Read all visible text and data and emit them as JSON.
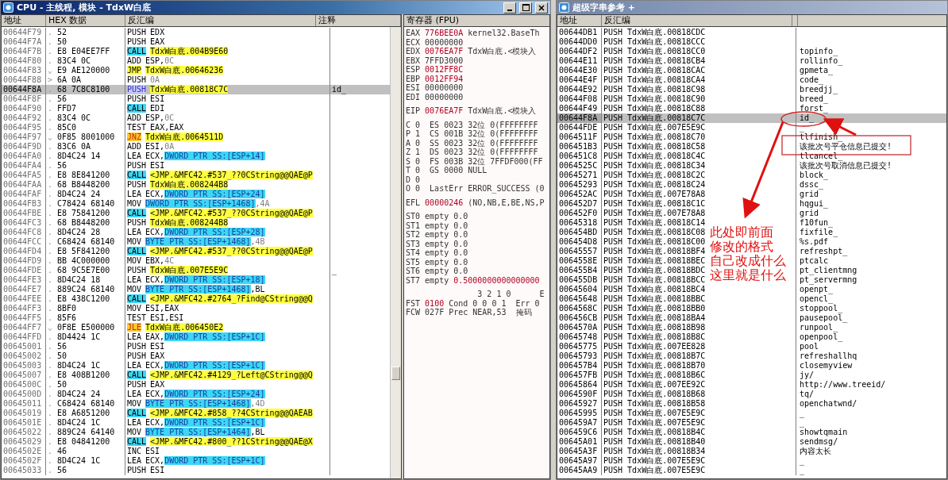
{
  "cpu_window": {
    "title": "CPU - 主线程, 模块 - TdxW白底"
  },
  "disasm": {
    "columns": [
      "地址",
      "HEX 数据",
      "反汇编",
      "注释"
    ],
    "rows": [
      {
        "address": "00644F79",
        "marker": ".",
        "hex": "52",
        "asm": [
          {
            "text": "PUSH",
            "kind": "plain"
          },
          {
            "text": "EDX",
            "kind": "plain"
          }
        ],
        "selected": false
      },
      {
        "address": "00644F7A",
        "marker": ".",
        "hex": "50",
        "asm": [
          {
            "text": "PUSH",
            "kind": "plain"
          },
          {
            "text": "EAX",
            "kind": "plain"
          }
        ],
        "selected": false
      },
      {
        "address": "00644F7B",
        "marker": ".",
        "hex": "E8 E04EE7FF",
        "asm": [
          {
            "text": "CALL",
            "kind": "call"
          },
          {
            "text": "TdxW白底.004B9E60",
            "kind": "target"
          }
        ],
        "selected": false
      },
      {
        "address": "00644F80",
        "marker": ".",
        "hex": "83C4 0C",
        "asm": [
          {
            "text": "ADD",
            "kind": "plain"
          },
          {
            "text": "ESP,",
            "kind": "plain"
          },
          {
            "text": "0C",
            "kind": "num"
          }
        ],
        "selected": false
      },
      {
        "address": "00644F83",
        "marker": "⌄",
        "hex": "E9 AE120000",
        "asm": [
          {
            "text": "JMP",
            "kind": "jmp"
          },
          {
            "text": "TdxW白底.00646236",
            "kind": "target"
          }
        ],
        "selected": false
      },
      {
        "address": "00644F88",
        "marker": ">",
        "hex": "6A 0A",
        "asm": [
          {
            "text": "PUSH",
            "kind": "plain"
          },
          {
            "text": "0A",
            "kind": "num"
          }
        ],
        "selected": false
      },
      {
        "address": "00644F8A",
        "marker": ".",
        "hex": "68 7C8C8100",
        "asm": [
          {
            "text": "PUSH",
            "kind": "mark"
          },
          {
            "text": "TdxW白底.00818C7C",
            "kind": "target"
          }
        ],
        "comment": "id_",
        "selected": true
      },
      {
        "address": "00644F8F",
        "marker": ".",
        "hex": "56",
        "asm": [
          {
            "text": "PUSH",
            "kind": "plain"
          },
          {
            "text": "ESI",
            "kind": "plain"
          }
        ],
        "selected": false
      },
      {
        "address": "00644F90",
        "marker": ".",
        "hex": "FFD7",
        "asm": [
          {
            "text": "CALL",
            "kind": "call"
          },
          {
            "text": "EDI",
            "kind": "plain"
          }
        ],
        "selected": false
      },
      {
        "address": "00644F92",
        "marker": ".",
        "hex": "83C4 0C",
        "asm": [
          {
            "text": "ADD",
            "kind": "plain"
          },
          {
            "text": "ESP,",
            "kind": "plain"
          },
          {
            "text": "0C",
            "kind": "num"
          }
        ],
        "selected": false
      },
      {
        "address": "00644F95",
        "marker": ".",
        "hex": "85C0",
        "asm": [
          {
            "text": "TEST",
            "kind": "plain"
          },
          {
            "text": "EAX,EAX",
            "kind": "plain"
          }
        ],
        "selected": false
      },
      {
        "address": "00644F97",
        "marker": "⌄",
        "hex": "0F85 8001000",
        "asm": [
          {
            "text": "JNZ",
            "kind": "jump"
          },
          {
            "text": "TdxW白底.0064511D",
            "kind": "target"
          }
        ],
        "selected": false
      },
      {
        "address": "00644F9D",
        "marker": ".",
        "hex": "83C6 0A",
        "asm": [
          {
            "text": "ADD",
            "kind": "plain"
          },
          {
            "text": "ESI,",
            "kind": "plain"
          },
          {
            "text": "0A",
            "kind": "num"
          }
        ],
        "selected": false
      },
      {
        "address": "00644FA0",
        "marker": ".",
        "hex": "8D4C24 14",
        "asm": [
          {
            "text": "LEA",
            "kind": "plain"
          },
          {
            "text": "ECX,",
            "kind": "plain"
          },
          {
            "text": "DWORD PTR SS:[ESP+14]",
            "kind": "mem"
          }
        ],
        "selected": false
      },
      {
        "address": "00644FA4",
        "marker": ".",
        "hex": "56",
        "asm": [
          {
            "text": "PUSH",
            "kind": "plain"
          },
          {
            "text": "ESI",
            "kind": "plain"
          }
        ],
        "selected": false
      },
      {
        "address": "00644FA5",
        "marker": ".",
        "hex": "E8 8E841200",
        "asm": [
          {
            "text": "CALL",
            "kind": "call"
          },
          {
            "text": "<JMP.&MFC42.#537_??0CString@@QAE@P",
            "kind": "target"
          }
        ],
        "selected": false
      },
      {
        "address": "00644FAA",
        "marker": ".",
        "hex": "68 B8448200",
        "asm": [
          {
            "text": "PUSH",
            "kind": "plain"
          },
          {
            "text": "TdxW白底.008244B8",
            "kind": "target"
          }
        ],
        "selected": false
      },
      {
        "address": "00644FAF",
        "marker": ".",
        "hex": "8D4C24 24",
        "asm": [
          {
            "text": "LEA",
            "kind": "plain"
          },
          {
            "text": "ECX,",
            "kind": "plain"
          },
          {
            "text": "DWORD PTR SS:[ESP+24]",
            "kind": "mem"
          }
        ],
        "selected": false
      },
      {
        "address": "00644FB3",
        "marker": ".",
        "hex": "C78424 68140",
        "asm": [
          {
            "text": "MOV",
            "kind": "plain"
          },
          {
            "text": "DWORD PTR SS:[ESP+1468]",
            "kind": "mem"
          },
          {
            "text": ",4A",
            "kind": "num"
          }
        ],
        "selected": false
      },
      {
        "address": "00644FBE",
        "marker": ".",
        "hex": "E8 75841200",
        "asm": [
          {
            "text": "CALL",
            "kind": "call"
          },
          {
            "text": "<JMP.&MFC42.#537_??0CString@@QAE@P",
            "kind": "target"
          }
        ],
        "selected": false
      },
      {
        "address": "00644FC3",
        "marker": ".",
        "hex": "68 B8448200",
        "asm": [
          {
            "text": "PUSH",
            "kind": "plain"
          },
          {
            "text": "TdxW白底.008244B8",
            "kind": "target"
          }
        ],
        "selected": false
      },
      {
        "address": "00644FC8",
        "marker": ".",
        "hex": "8D4C24 28",
        "asm": [
          {
            "text": "LEA",
            "kind": "plain"
          },
          {
            "text": "ECX,",
            "kind": "plain"
          },
          {
            "text": "DWORD PTR SS:[ESP+28]",
            "kind": "mem"
          }
        ],
        "selected": false
      },
      {
        "address": "00644FCC",
        "marker": ".",
        "hex": "C68424 68140",
        "asm": [
          {
            "text": "MOV",
            "kind": "plain"
          },
          {
            "text": "BYTE PTR SS:[ESP+1468]",
            "kind": "mem"
          },
          {
            "text": ",4B",
            "kind": "num"
          }
        ],
        "selected": false
      },
      {
        "address": "00644FD4",
        "marker": ".",
        "hex": "E8 5F841200",
        "asm": [
          {
            "text": "CALL",
            "kind": "call"
          },
          {
            "text": "<JMP.&MFC42.#537_??0CString@@QAE@P",
            "kind": "target"
          }
        ],
        "selected": false
      },
      {
        "address": "00644FD9",
        "marker": ".",
        "hex": "BB 4C000000",
        "asm": [
          {
            "text": "MOV",
            "kind": "plain"
          },
          {
            "text": "EBX,",
            "kind": "plain"
          },
          {
            "text": "4C",
            "kind": "num"
          }
        ],
        "selected": false
      },
      {
        "address": "00644FDE",
        "marker": ".",
        "hex": "68 9C5E7E00",
        "asm": [
          {
            "text": "PUSH",
            "kind": "plain"
          },
          {
            "text": "TdxW白底.007E5E9C",
            "kind": "target"
          }
        ],
        "comment": "_",
        "selected": false
      },
      {
        "address": "00644FE3",
        "marker": ".",
        "hex": "8D4C24 18",
        "asm": [
          {
            "text": "LEA",
            "kind": "plain"
          },
          {
            "text": "ECX,",
            "kind": "plain"
          },
          {
            "text": "DWORD PTR SS:[ESP+18]",
            "kind": "mem"
          }
        ],
        "selected": false
      },
      {
        "address": "00644FE7",
        "marker": ".",
        "hex": "889C24 68140",
        "asm": [
          {
            "text": "MOV",
            "kind": "plain"
          },
          {
            "text": "BYTE PTR SS:[ESP+1468]",
            "kind": "mem"
          },
          {
            "text": ",BL",
            "kind": "plain"
          }
        ],
        "selected": false
      },
      {
        "address": "00644FEE",
        "marker": ".",
        "hex": "E8 438C1200",
        "asm": [
          {
            "text": "CALL",
            "kind": "call"
          },
          {
            "text": "<JMP.&MFC42.#2764_?Find@CString@@Q",
            "kind": "target"
          }
        ],
        "selected": false
      },
      {
        "address": "00644FF3",
        "marker": ".",
        "hex": "8BF0",
        "asm": [
          {
            "text": "MOV",
            "kind": "plain"
          },
          {
            "text": "ESI,EAX",
            "kind": "plain"
          }
        ],
        "selected": false
      },
      {
        "address": "00644FF5",
        "marker": ".",
        "hex": "85F6",
        "asm": [
          {
            "text": "TEST",
            "kind": "plain"
          },
          {
            "text": "ESI,ESI",
            "kind": "plain"
          }
        ],
        "selected": false
      },
      {
        "address": "00644FF7",
        "marker": "⌄",
        "hex": "0F8E E500000",
        "asm": [
          {
            "text": "JLE",
            "kind": "jump"
          },
          {
            "text": "TdxW白底.006450E2",
            "kind": "target"
          }
        ],
        "selected": false
      },
      {
        "address": "00644FFD",
        "marker": ".",
        "hex": "8D4424 1C",
        "asm": [
          {
            "text": "LEA",
            "kind": "plain"
          },
          {
            "text": "EAX,",
            "kind": "plain"
          },
          {
            "text": "DWORD PTR SS:[ESP+1C]",
            "kind": "mem"
          }
        ],
        "selected": false
      },
      {
        "address": "00645001",
        "marker": ".",
        "hex": "56",
        "asm": [
          {
            "text": "PUSH",
            "kind": "plain"
          },
          {
            "text": "ESI",
            "kind": "plain"
          }
        ],
        "selected": false
      },
      {
        "address": "00645002",
        "marker": ".",
        "hex": "50",
        "asm": [
          {
            "text": "PUSH",
            "kind": "plain"
          },
          {
            "text": "EAX",
            "kind": "plain"
          }
        ],
        "selected": false
      },
      {
        "address": "00645003",
        "marker": ".",
        "hex": "8D4C24 1C",
        "asm": [
          {
            "text": "LEA",
            "kind": "plain"
          },
          {
            "text": "ECX,",
            "kind": "plain"
          },
          {
            "text": "DWORD PTR SS:[ESP+1C]",
            "kind": "mem"
          }
        ],
        "selected": false
      },
      {
        "address": "00645007",
        "marker": ".",
        "hex": "E8 408B1200",
        "asm": [
          {
            "text": "CALL",
            "kind": "call"
          },
          {
            "text": "<JMP.&MFC42.#4129_?Left@CString@@Q",
            "kind": "target"
          }
        ],
        "selected": false
      },
      {
        "address": "0064500C",
        "marker": ".",
        "hex": "50",
        "asm": [
          {
            "text": "PUSH",
            "kind": "plain"
          },
          {
            "text": "EAX",
            "kind": "plain"
          }
        ],
        "selected": false
      },
      {
        "address": "0064500D",
        "marker": ".",
        "hex": "8D4C24 24",
        "asm": [
          {
            "text": "LEA",
            "kind": "plain"
          },
          {
            "text": "ECX,",
            "kind": "plain"
          },
          {
            "text": "DWORD PTR SS:[ESP+24]",
            "kind": "mem"
          }
        ],
        "selected": false
      },
      {
        "address": "00645011",
        "marker": ".",
        "hex": "C68424 68140",
        "asm": [
          {
            "text": "MOV",
            "kind": "plain"
          },
          {
            "text": "BYTE PTR SS:[ESP+1468]",
            "kind": "mem"
          },
          {
            "text": ",4D",
            "kind": "num"
          }
        ],
        "selected": false
      },
      {
        "address": "00645019",
        "marker": ".",
        "hex": "E8 A6851200",
        "asm": [
          {
            "text": "CALL",
            "kind": "call"
          },
          {
            "text": "<JMP.&MFC42.#858_??4CString@@QAEAB",
            "kind": "target"
          }
        ],
        "selected": false
      },
      {
        "address": "0064501E",
        "marker": ".",
        "hex": "8D4C24 1C",
        "asm": [
          {
            "text": "LEA",
            "kind": "plain"
          },
          {
            "text": "ECX,",
            "kind": "plain"
          },
          {
            "text": "DWORD PTR SS:[ESP+1C]",
            "kind": "mem"
          }
        ],
        "selected": false
      },
      {
        "address": "00645022",
        "marker": ".",
        "hex": "889C24 64140",
        "asm": [
          {
            "text": "MOV",
            "kind": "plain"
          },
          {
            "text": "BYTE PTR SS:[ESP+1464]",
            "kind": "mem"
          },
          {
            "text": ",BL",
            "kind": "plain"
          }
        ],
        "selected": false
      },
      {
        "address": "00645029",
        "marker": ".",
        "hex": "E8 04841200",
        "asm": [
          {
            "text": "CALL",
            "kind": "call"
          },
          {
            "text": "<JMP.&MFC42.#800_??1CString@@QAE@X",
            "kind": "target"
          }
        ],
        "selected": false
      },
      {
        "address": "0064502E",
        "marker": ".",
        "hex": "46",
        "asm": [
          {
            "text": "INC",
            "kind": "plain"
          },
          {
            "text": "ESI",
            "kind": "plain"
          }
        ],
        "selected": false
      },
      {
        "address": "0064502F",
        "marker": ".",
        "hex": "8D4C24 1C",
        "asm": [
          {
            "text": "LEA",
            "kind": "plain"
          },
          {
            "text": "ECX,",
            "kind": "plain"
          },
          {
            "text": "DWORD PTR SS:[ESP+1C]",
            "kind": "mem"
          }
        ],
        "selected": false
      },
      {
        "address": "00645033",
        "marker": ".",
        "hex": "56",
        "asm": [
          {
            "text": "PUSH",
            "kind": "plain"
          },
          {
            "text": "ESI",
            "kind": "plain"
          }
        ],
        "selected": false
      }
    ]
  },
  "registers": {
    "title": "寄存器 (FPU)",
    "groups": [
      [
        {
          "kind": "reg",
          "name": "EAX",
          "value": "776BEE0A",
          "note": "kernel32.BaseTh",
          "changed": true
        },
        {
          "kind": "reg",
          "name": "ECX",
          "value": "00000000",
          "changed": false
        },
        {
          "kind": "reg",
          "name": "EDX",
          "value": "0076EA7F",
          "note": "TdxW白底.<模块入",
          "changed": true
        },
        {
          "kind": "reg",
          "name": "EBX",
          "value": "7FFD3000",
          "changed": false
        },
        {
          "kind": "reg",
          "name": "ESP",
          "value": "0012FF8C",
          "changed": true
        },
        {
          "kind": "reg",
          "name": "EBP",
          "value": "0012FF94",
          "changed": true
        },
        {
          "kind": "reg",
          "name": "ESI",
          "value": "00000000",
          "changed": false
        },
        {
          "kind": "reg",
          "name": "EDI",
          "value": "00000000",
          "changed": false
        }
      ],
      [
        {
          "kind": "reg",
          "name": "EIP",
          "value": "0076EA7F",
          "note": "TdxW白底.<模块入",
          "changed": true
        }
      ],
      [
        {
          "kind": "text",
          "text": "C 0  ES 0023 32位 0(FFFFFFFF"
        },
        {
          "kind": "text",
          "text": "P 1  CS 001B 32位 0(FFFFFFFF"
        },
        {
          "kind": "text",
          "text": "A 0  SS 0023 32位 0(FFFFFFFF"
        },
        {
          "kind": "text",
          "text": "Z 1  DS 0023 32位 0(FFFFFFFF"
        },
        {
          "kind": "text",
          "text": "S 0  FS 003B 32位 7FFDF000(FF"
        },
        {
          "kind": "text",
          "text": "T 0  GS 0000 NULL"
        },
        {
          "kind": "text",
          "text": "D 0"
        },
        {
          "kind": "text",
          "text": "O 0  LastErr ERROR_SUCCESS (0"
        }
      ],
      [
        {
          "kind": "reg",
          "name": "EFL",
          "value": "00000246",
          "note": "(NO,NB,E,BE,NS,P",
          "changed": true
        }
      ],
      [
        {
          "kind": "fpu",
          "name": "ST0",
          "value": "empty",
          "note": "0.0",
          "changed": false
        },
        {
          "kind": "fpu",
          "name": "ST1",
          "value": "empty",
          "note": "0.0",
          "changed": false
        },
        {
          "kind": "fpu",
          "name": "ST2",
          "value": "empty",
          "note": "0.0",
          "changed": false
        },
        {
          "kind": "fpu",
          "name": "ST3",
          "value": "empty",
          "note": "0.0",
          "changed": false
        },
        {
          "kind": "fpu",
          "name": "ST4",
          "value": "empty",
          "note": "0.0",
          "changed": false
        },
        {
          "kind": "fpu",
          "name": "ST5",
          "value": "empty",
          "note": "0.0",
          "changed": false
        },
        {
          "kind": "fpu",
          "name": "ST6",
          "value": "empty",
          "note": "0.0",
          "changed": false
        },
        {
          "kind": "fpu",
          "name": "ST7",
          "value": "empty",
          "note": "0.5000000000000000",
          "changed": true
        }
      ],
      [
        {
          "kind": "text",
          "text": "               3 2 1 0      E"
        },
        {
          "kind": "reg",
          "name": "FST",
          "value": "0100",
          "note": "Cond 0 0 0 1  Err 0",
          "changed": true
        },
        {
          "kind": "reg",
          "name": "FCW",
          "value": "027F",
          "note": "Prec NEAR,53  掩码",
          "changed": false
        }
      ]
    ]
  },
  "strings_window": {
    "title": "超级字串参考 +",
    "columns": [
      "地址",
      "反汇编"
    ],
    "rows": [
      {
        "address": "00644DB1",
        "disasm": "PUSH TdxW白底.00818CDC",
        "selected": false
      },
      {
        "address": "00644DD0",
        "disasm": "PUSH TdxW白底.00818CCC",
        "selected": false
      },
      {
        "address": "00644DF2",
        "disasm": "PUSH TdxW白底.00818CC0",
        "text": "topinfo_",
        "selected": false
      },
      {
        "address": "00644E11",
        "disasm": "PUSH TdxW白底.00818CB4",
        "text": "rollinfo_",
        "selected": false
      },
      {
        "address": "00644E30",
        "disasm": "PUSH TdxW白底.00818CAC",
        "text": "gpmeta_",
        "selected": false
      },
      {
        "address": "00644E4F",
        "disasm": "PUSH TdxW白底.00818CA4",
        "text": "code_",
        "selected": false
      },
      {
        "address": "00644E92",
        "disasm": "PUSH TdxW白底.00818C98",
        "text": "breedjj_",
        "selected": false
      },
      {
        "address": "00644F08",
        "disasm": "PUSH TdxW白底.00818C90",
        "text": "breed_",
        "selected": false
      },
      {
        "address": "00644F49",
        "disasm": "PUSH TdxW白底.00818C88",
        "text": "forst_",
        "selected": false
      },
      {
        "address": "00644F8A",
        "disasm": "PUSH TdxW白底.00818C7C",
        "text": "id_",
        "selected": true
      },
      {
        "address": "00644FDE",
        "disasm": "PUSH TdxW白底.007E5E9C",
        "text": "_",
        "selected": false
      },
      {
        "address": "0064511F",
        "disasm": "PUSH TdxW白底.00818C70",
        "text": "tlfinish_",
        "selected": false
      },
      {
        "address": "006451B3",
        "disasm": "PUSH TdxW白底.00818C58",
        "text": "该批次号平仓信息已提交!",
        "selected": false
      },
      {
        "address": "006451C8",
        "disasm": "PUSH TdxW白底.00818C4C",
        "text": "tlcancel_",
        "selected": false
      },
      {
        "address": "0064525C",
        "disasm": "PUSH TdxW白底.00818C34",
        "text": "该批次号取消信息已提交!",
        "selected": false
      },
      {
        "address": "00645271",
        "disasm": "PUSH TdxW白底.00818C2C",
        "text": "block_",
        "selected": false
      },
      {
        "address": "00645293",
        "disasm": "PUSH TdxW白底.00818C24",
        "text": "dssc_",
        "selected": false
      },
      {
        "address": "006452AC",
        "disasm": "PUSH TdxW白底.007E78A8",
        "text": "grid",
        "selected": false
      },
      {
        "address": "006452D7",
        "disasm": "PUSH TdxW白底.00818C1C",
        "text": "hqgui_",
        "selected": false
      },
      {
        "address": "006452F0",
        "disasm": "PUSH TdxW白底.007E78A8",
        "text": "grid",
        "selected": false
      },
      {
        "address": "00645318",
        "disasm": "PUSH TdxW白底.00818C14",
        "text": "f10fun_",
        "selected": false
      },
      {
        "address": "006454BD",
        "disasm": "PUSH TdxW白底.00818C08",
        "text": "fixfile_",
        "selected": false
      },
      {
        "address": "006454D8",
        "disasm": "PUSH TdxW白底.00818C00",
        "text": "%s.pdf",
        "selected": false
      },
      {
        "address": "00645557",
        "disasm": "PUSH TdxW白底.00818BF4",
        "text": "refreshpt_",
        "selected": false
      },
      {
        "address": "0064558E",
        "disasm": "PUSH TdxW白底.00818BEC",
        "text": "ptcalc",
        "selected": false
      },
      {
        "address": "006455B4",
        "disasm": "PUSH TdxW白底.00818BDC",
        "text": "pt_clientmng",
        "selected": false
      },
      {
        "address": "006455DB",
        "disasm": "PUSH TdxW白底.00818BCC",
        "text": "pt_servermng",
        "selected": false
      },
      {
        "address": "00645604",
        "disasm": "PUSH TdxW白底.00818BC4",
        "text": "openpt_",
        "selected": false
      },
      {
        "address": "00645648",
        "disasm": "PUSH TdxW白底.00818BBC",
        "text": "opencl_",
        "selected": false
      },
      {
        "address": "0064568C",
        "disasm": "PUSH TdxW白底.00818BB0",
        "text": "stoppool_",
        "selected": false
      },
      {
        "address": "006456CB",
        "disasm": "PUSH TdxW白底.00818BA4",
        "text": "pausepool_",
        "selected": false
      },
      {
        "address": "0064570A",
        "disasm": "PUSH TdxW白底.00818B98",
        "text": "runpool_",
        "selected": false
      },
      {
        "address": "00645748",
        "disasm": "PUSH TdxW白底.00818B8C",
        "text": "openpool_",
        "selected": false
      },
      {
        "address": "00645775",
        "disasm": "PUSH TdxW白底.007EE828",
        "text": "pool",
        "selected": false
      },
      {
        "address": "00645793",
        "disasm": "PUSH TdxW白底.00818B7C",
        "text": "refreshallhq",
        "selected": false
      },
      {
        "address": "006457B4",
        "disasm": "PUSH TdxW白底.00818B70",
        "text": "closemyview",
        "selected": false
      },
      {
        "address": "006457FB",
        "disasm": "PUSH TdxW白底.00818B6C",
        "text": "jy/",
        "selected": false
      },
      {
        "address": "00645864",
        "disasm": "PUSH TdxW白底.007EE92C",
        "text": "http://www.treeid/",
        "selected": false
      },
      {
        "address": "0064590F",
        "disasm": "PUSH TdxW白底.00818B68",
        "text": "tq/",
        "selected": false
      },
      {
        "address": "00645927",
        "disasm": "PUSH TdxW白底.00818B58",
        "text": "openchatwnd/",
        "selected": false
      },
      {
        "address": "00645995",
        "disasm": "PUSH TdxW白底.007E5E9C",
        "text": "_",
        "selected": false
      },
      {
        "address": "006459A7",
        "disasm": "PUSH TdxW白底.007E5E9C",
        "text": "_",
        "selected": false
      },
      {
        "address": "006459C6",
        "disasm": "PUSH TdxW白底.00818B4C",
        "text": "showtqmain",
        "selected": false
      },
      {
        "address": "00645A01",
        "disasm": "PUSH TdxW白底.00818B40",
        "text": "sendmsg/",
        "selected": false
      },
      {
        "address": "00645A3F",
        "disasm": "PUSH TdxW白底.00818B34",
        "text": "内容太长",
        "selected": false
      },
      {
        "address": "00645A97",
        "disasm": "PUSH TdxW白底.007E5E9C",
        "text": "_",
        "selected": false
      },
      {
        "address": "00645AA9",
        "disasm": "PUSH TdxW白底.007E5E9C",
        "text": "_",
        "selected": false
      }
    ]
  },
  "annotation": {
    "lines": [
      "此处即前面",
      "修改的格式",
      "自己改成什么",
      "这里就是什么"
    ]
  }
}
